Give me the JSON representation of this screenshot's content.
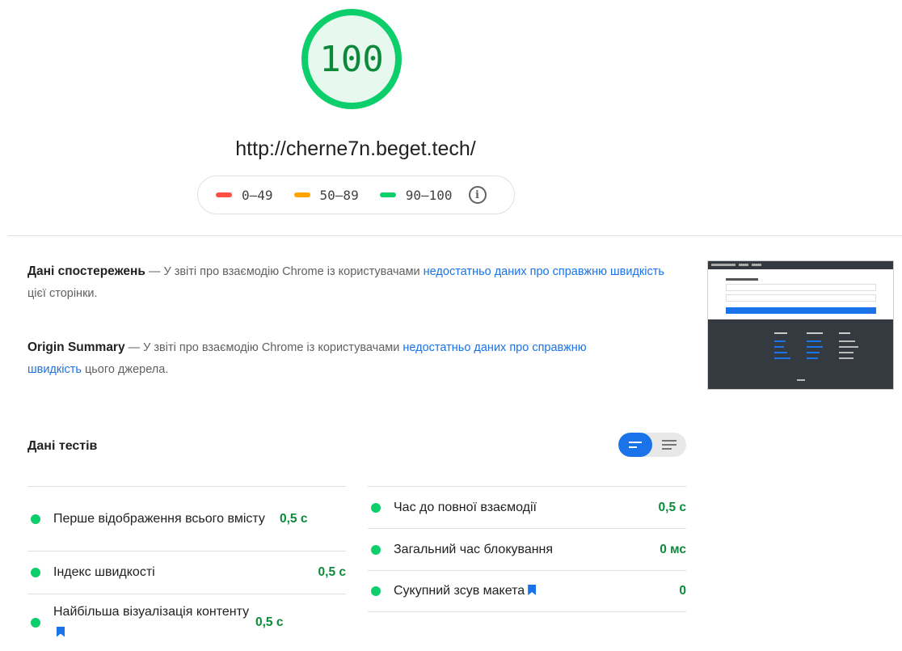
{
  "score": {
    "value": "100",
    "fraction": 1.0,
    "color": "#0cce6b",
    "fill": "#e7f8ee"
  },
  "url": "http://cherne7n.beget.tech/",
  "legend": [
    {
      "label": "0–49",
      "color": "#ff4e42"
    },
    {
      "label": "50–89",
      "color": "#ffa400"
    },
    {
      "label": "90–100",
      "color": "#0cce6b"
    }
  ],
  "field_data": {
    "title": "Дані спостережень",
    "text_before": " — У звіті про взаємодію Chrome із користувачами ",
    "link": "недостатньо даних про справжню швидкість",
    "text_after": " цієї сторінки."
  },
  "origin_summary": {
    "title": "Origin Summary",
    "text_before": "  — У звіті про взаємодію Chrome із користувачами ",
    "link": "недостатньо даних про справжню швидкість",
    "text_after": " цього джерела."
  },
  "lab_data_title": "Дані тестів",
  "metrics_left": [
    {
      "label": "Перше відображення всього вмісту",
      "value": "0,5 с",
      "bookmark": false
    },
    {
      "label": "Індекс швидкості",
      "value": "0,5 с",
      "bookmark": false
    },
    {
      "label": "Найбільша візуалізація контенту",
      "value": "0,5 с",
      "bookmark": true
    }
  ],
  "metrics_right": [
    {
      "label": "Час до повної взаємодії",
      "value": "0,5 с",
      "bookmark": false
    },
    {
      "label": "Загальний час блокування",
      "value": "0 мс",
      "bookmark": false
    },
    {
      "label": "Сукупний зсув макета",
      "value": "0",
      "bookmark": true
    }
  ]
}
